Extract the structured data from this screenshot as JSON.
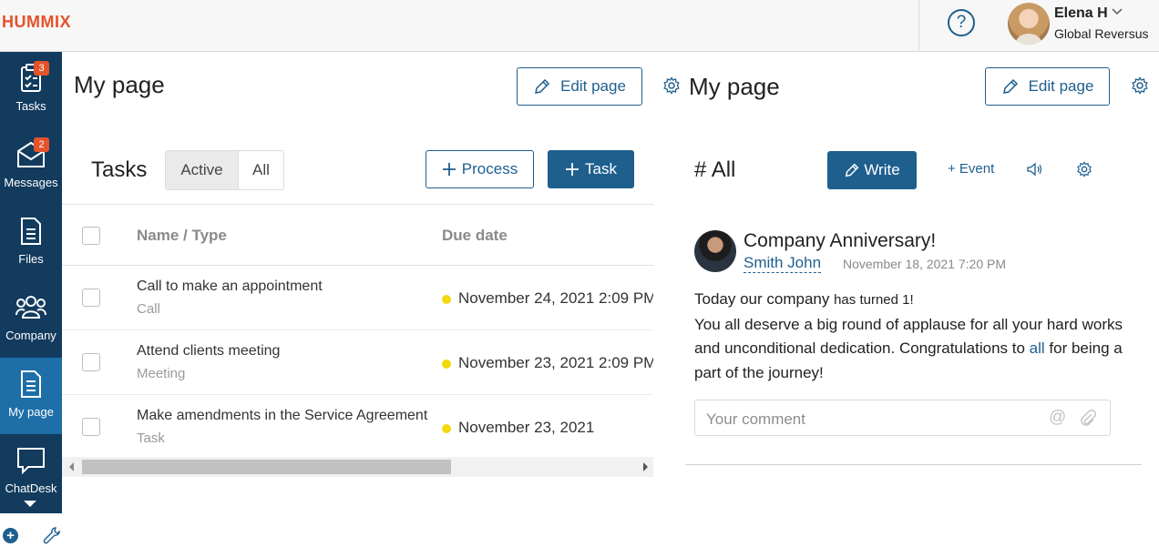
{
  "header": {
    "logo": "HUMMIX",
    "help_icon": "question-circle-icon",
    "user": {
      "name": "Elena H",
      "org": "Global Reversus"
    }
  },
  "sidebar": {
    "items": [
      {
        "label": "Tasks",
        "icon": "clipboard-check-icon",
        "badge": "3"
      },
      {
        "label": "Messages",
        "icon": "envelope-icon",
        "badge": "2"
      },
      {
        "label": "Files",
        "icon": "document-icon"
      },
      {
        "label": "Company",
        "icon": "people-icon"
      },
      {
        "label": "My page",
        "icon": "page-icon",
        "active": true
      },
      {
        "label": "ChatDesk",
        "icon": "chat-bubble-icon"
      }
    ]
  },
  "left": {
    "title": "My page",
    "edit_label": "Edit page",
    "tasks": {
      "title": "Tasks",
      "filter_active": "Active",
      "filter_all": "All",
      "process_label": "Process",
      "task_label": "Task",
      "columns": [
        "Name / Type",
        "Due date"
      ],
      "rows": [
        {
          "name": "Call to make an appointment",
          "type": "Call",
          "due": "November 24, 2021 2:09 PM"
        },
        {
          "name": "Attend clients meeting",
          "type": "Meeting",
          "due": "November 23, 2021 2:09 PM"
        },
        {
          "name": "Make amendments in the Service Agreement",
          "type": "Task",
          "due": "November 23, 2021"
        }
      ]
    }
  },
  "right": {
    "title": "My page",
    "edit_label": "Edit page",
    "feed": {
      "title": "# All",
      "write_label": "Write",
      "event_label": "+ Event"
    },
    "post": {
      "title": "Company Anniversary!",
      "author": "Smith John",
      "date": "November 18, 2021 7:20 PM",
      "line1_a": "Today our company ",
      "line1_b": "has turned 1!",
      "line2": "You all deserve a big round of applause for all your hard works and unconditional dedication. Congratulations to ",
      "link": "all",
      "line3": " for being a part of the journey!"
    },
    "comment_placeholder": "Your comment"
  },
  "colors": {
    "brand": "#1e5f8e",
    "sidebar": "#123b5e",
    "logo": "#e4532b",
    "badge": "#e4532b",
    "status_dot": "#f2d90c"
  }
}
